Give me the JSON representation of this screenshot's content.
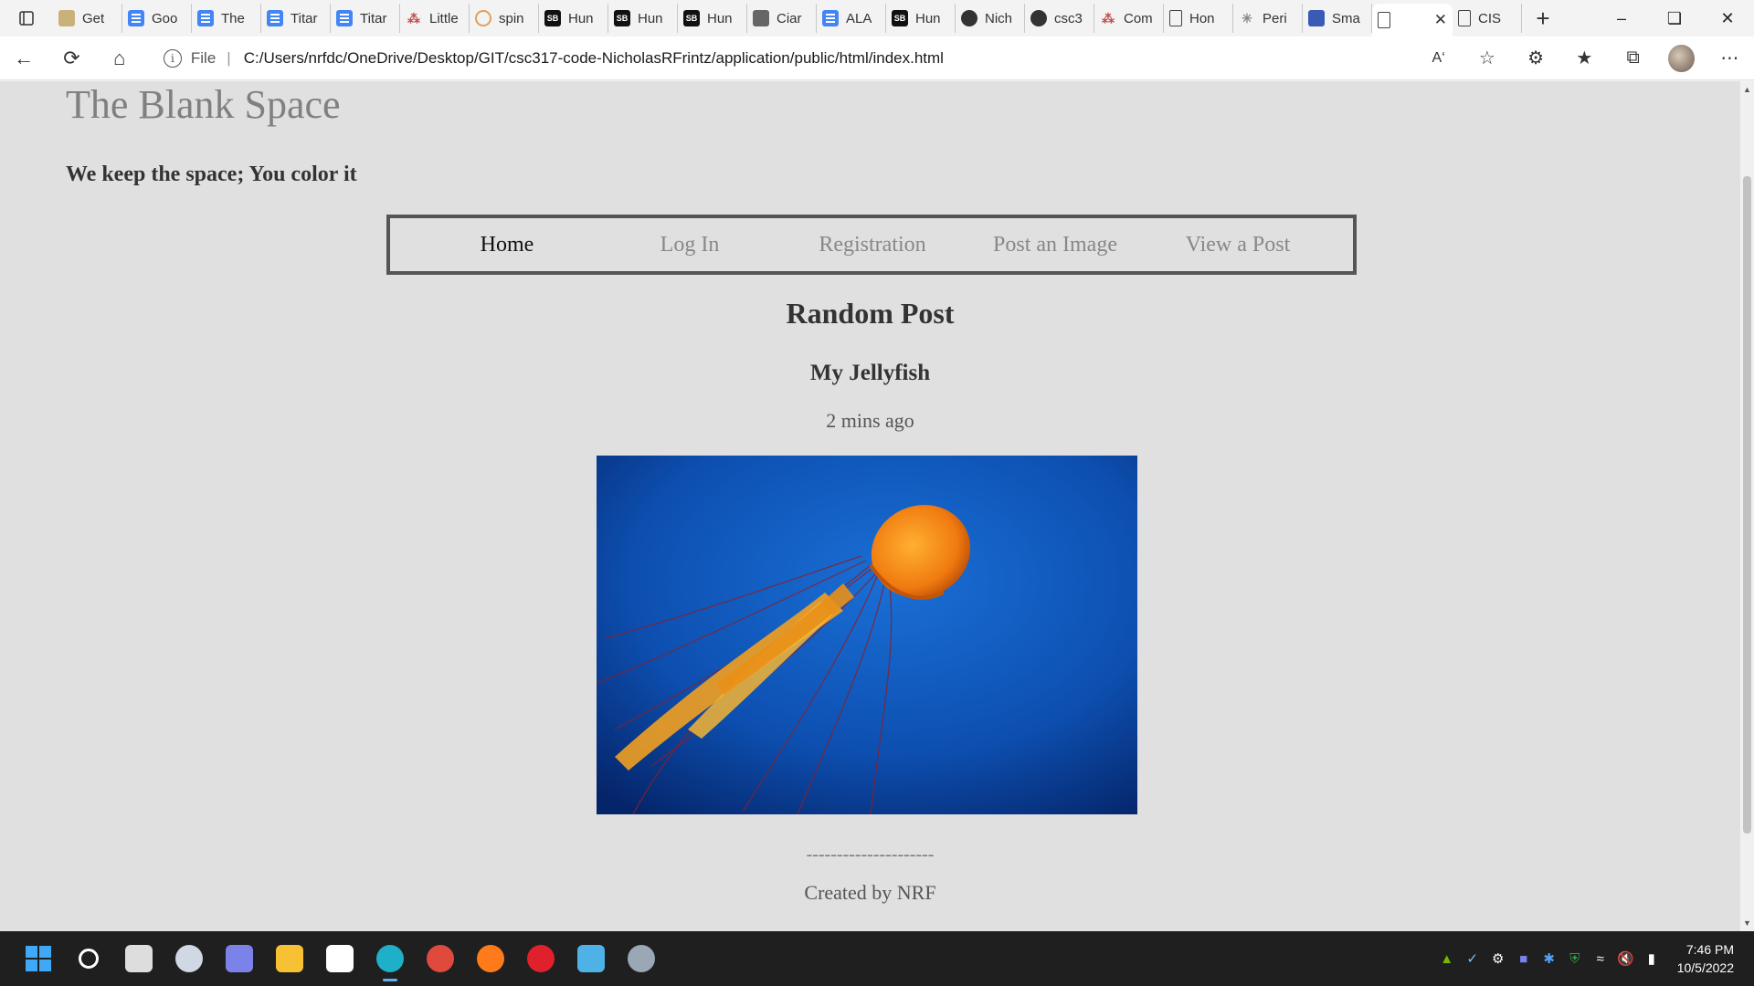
{
  "browser": {
    "tabs": [
      {
        "title": "Get",
        "favicon": "image-favicon"
      },
      {
        "title": "Goo",
        "favicon": "google-docs-favicon"
      },
      {
        "title": "The",
        "favicon": "google-docs-favicon"
      },
      {
        "title": "Titar",
        "favicon": "google-docs-favicon"
      },
      {
        "title": "Titar",
        "favicon": "google-docs-favicon"
      },
      {
        "title": "Little",
        "favicon": "red-figure-favicon"
      },
      {
        "title": "spin",
        "favicon": "ring-favicon"
      },
      {
        "title": "Hun",
        "favicon": "sb-favicon"
      },
      {
        "title": "Hun",
        "favicon": "sb-favicon"
      },
      {
        "title": "Hun",
        "favicon": "sb-favicon"
      },
      {
        "title": "Ciar",
        "favicon": "grey-square-favicon"
      },
      {
        "title": "ALA",
        "favicon": "google-docs-favicon"
      },
      {
        "title": "Hun",
        "favicon": "sb-favicon"
      },
      {
        "title": "Nich",
        "favicon": "github-favicon"
      },
      {
        "title": "csc3",
        "favicon": "github-favicon"
      },
      {
        "title": "Com",
        "favicon": "red-figure-favicon"
      },
      {
        "title": "Hon",
        "favicon": "page-favicon"
      },
      {
        "title": "Peri",
        "favicon": "star-favicon"
      },
      {
        "title": "Sma",
        "favicon": "lines-favicon"
      },
      {
        "title": "",
        "favicon": "page-favicon",
        "active": true
      },
      {
        "title": "CIS",
        "favicon": "page-favicon"
      }
    ],
    "address": {
      "scheme_label": "File",
      "url": "C:/Users/nrfdc/OneDrive/Desktop/GIT/csc317-code-NicholasRFrintz/application/public/html/index.html"
    }
  },
  "site": {
    "title": "The Blank Space",
    "tagline": "We keep the space; You color it",
    "nav": [
      {
        "label": "Home",
        "current": true
      },
      {
        "label": "Log In",
        "current": false
      },
      {
        "label": "Registration",
        "current": false
      },
      {
        "label": "Post an Image",
        "current": false
      },
      {
        "label": "View a Post",
        "current": false
      }
    ],
    "post": {
      "heading": "Random Post",
      "title": "My Jellyfish",
      "time": "2 mins ago",
      "image": "orange-jellyfish-photo"
    },
    "footer": {
      "divider": "---------------------",
      "credit": "Created by NRF"
    }
  },
  "taskbar": {
    "apps": [
      "start-icon",
      "search-icon",
      "task-view-icon",
      "widgets-icon",
      "chat-icon",
      "file-explorer-icon",
      "store-icon",
      "edge-icon",
      "chrome-icon",
      "firefox-icon",
      "opera-icon",
      "notepad-icon",
      "settings-icon"
    ],
    "time": "7:46 PM",
    "date": "10/5/2022"
  },
  "colors": {
    "page_background": "#e0e0e0",
    "nav_border": "#555555",
    "nav_inactive": "#888888",
    "nav_active": "#111111",
    "title": "#808080"
  }
}
